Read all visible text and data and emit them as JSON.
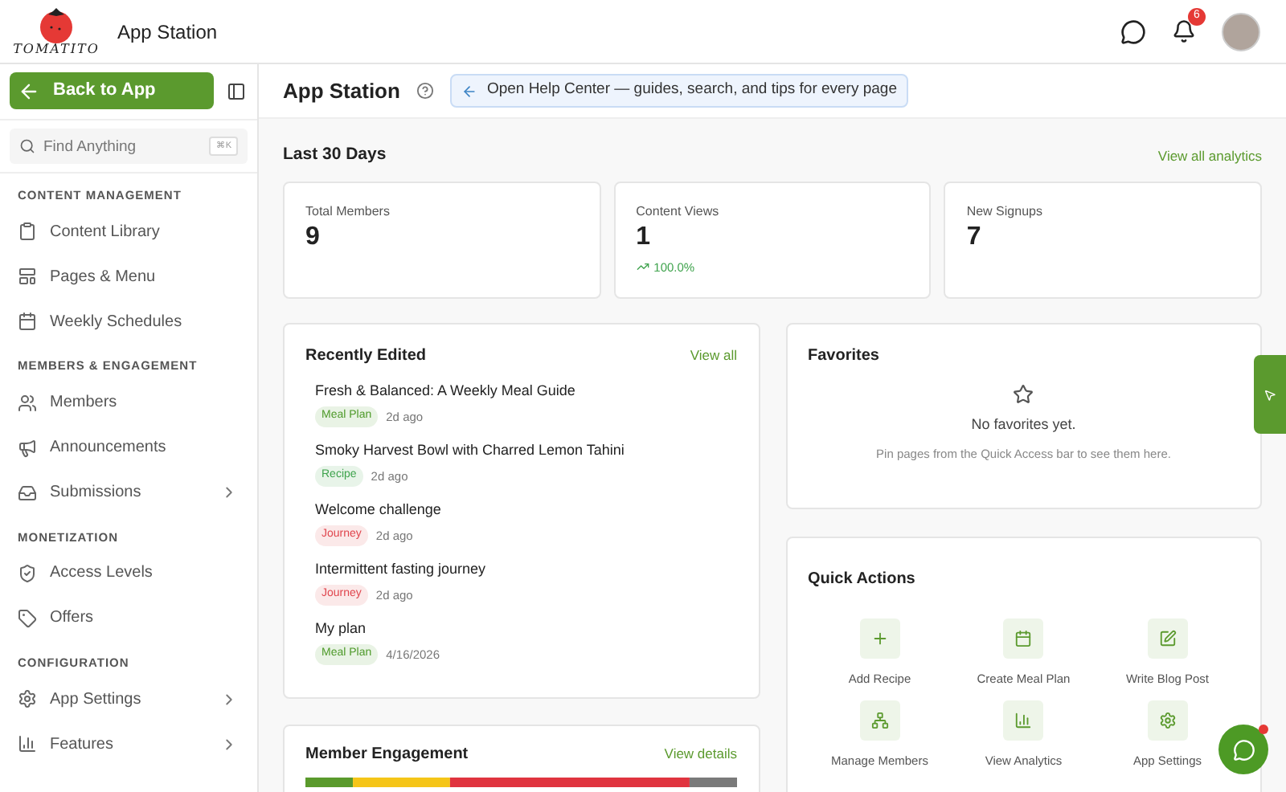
{
  "header": {
    "logo": "TOMATITO",
    "title": "App Station",
    "notifications": "6"
  },
  "sidebar": {
    "back_button": "Back to App",
    "search": {
      "placeholder": "Find Anything",
      "shortcut": "⌘K"
    },
    "sections": [
      {
        "title": "CONTENT MANAGEMENT",
        "items": [
          {
            "label": "Content Library",
            "expandable": false
          },
          {
            "label": "Pages & Menu",
            "expandable": false
          },
          {
            "label": "Weekly Schedules",
            "expandable": false
          }
        ]
      },
      {
        "title": "MEMBERS & ENGAGEMENT",
        "items": [
          {
            "label": "Members",
            "expandable": false
          },
          {
            "label": "Announcements",
            "expandable": false
          },
          {
            "label": "Submissions",
            "expandable": true
          }
        ]
      },
      {
        "title": "MONETIZATION",
        "items": [
          {
            "label": "Access Levels",
            "expandable": false
          },
          {
            "label": "Offers",
            "expandable": false
          }
        ]
      },
      {
        "title": "CONFIGURATION",
        "items": [
          {
            "label": "App Settings",
            "expandable": true
          },
          {
            "label": "Features",
            "expandable": true
          }
        ]
      }
    ]
  },
  "toolbar": {
    "title": "App Station",
    "help_banner": "Open Help Center — guides, search, and tips for every page"
  },
  "stats": {
    "title": "Last 30 Days",
    "link": "View all analytics",
    "cards": [
      {
        "label": "Total Members",
        "value": "9"
      },
      {
        "label": "Content Views",
        "value": "1",
        "change": "100.0%"
      },
      {
        "label": "New Signups",
        "value": "7"
      }
    ]
  },
  "recently_edited": {
    "title": "Recently Edited",
    "link": "View all",
    "items": [
      {
        "title": "Fresh & Balanced: A Weekly Meal Guide",
        "tag": "Meal Plan",
        "color": "#4e9a2a",
        "time": "2d ago"
      },
      {
        "title": "Smoky Harvest Bowl with Charred Lemon Tahini",
        "tag": "Recipe",
        "color": "#3fa34d",
        "time": "2d ago"
      },
      {
        "title": "Welcome challenge",
        "tag": "Journey",
        "color": "#e0464e",
        "time": "2d ago"
      },
      {
        "title": "Intermittent fasting journey",
        "tag": "Journey",
        "color": "#e0464e",
        "time": "2d ago"
      },
      {
        "title": "My plan",
        "tag": "Meal Plan",
        "color": "#4e9a2a",
        "time": "4/16/2026"
      }
    ]
  },
  "favorites": {
    "title": "Favorites",
    "empty_title": "No favorites yet.",
    "empty_text": "Pin pages from the Quick Access bar to see them here."
  },
  "quick_actions": {
    "title": "Quick Actions",
    "items": [
      {
        "label": "Add Recipe"
      },
      {
        "label": "Create Meal Plan"
      },
      {
        "label": "Write Blog Post"
      },
      {
        "label": "Manage Members"
      },
      {
        "label": "View Analytics"
      },
      {
        "label": "App Settings"
      }
    ]
  },
  "member_engagement": {
    "title": "Member Engagement",
    "link": "View details"
  }
}
